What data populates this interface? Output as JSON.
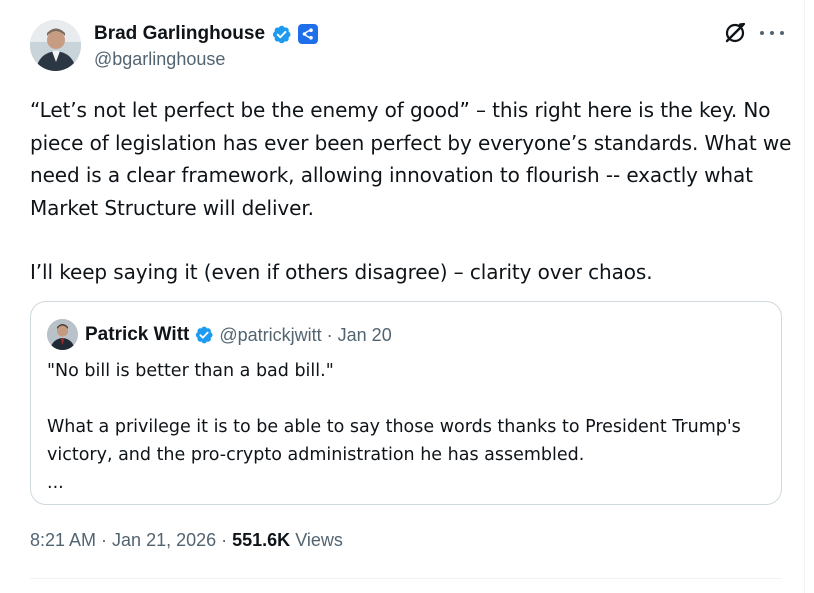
{
  "author": {
    "display_name": "Brad Garlinghouse",
    "handle": "@bgarlinghouse",
    "verified_badge_icon": "verified-badge-icon",
    "affiliation_icon": "ripple-affiliate-icon"
  },
  "header_actions": {
    "grok_icon": "grok-icon",
    "more_icon": "more-horizontal-icon"
  },
  "tweet": {
    "paragraph_1": "“Let’s not let perfect be the enemy of good” – this right here is the key. No piece of legislation has ever been perfect by everyone’s standards. What we need is a clear framework, allowing innovation to flourish -- exactly what Market Structure will deliver.",
    "paragraph_2": "I’ll keep saying it (even if others disagree) – clarity over chaos."
  },
  "quote": {
    "display_name": "Patrick Witt",
    "handle": "@patrickjwitt",
    "separator": "·",
    "date": "Jan 20",
    "line_1": "\"No bill is better than a bad bill.\"",
    "line_2": "What a privilege it is to be able to say those words thanks to President Trump's victory, and the pro-crypto administration he has assembled.",
    "line_3": "..."
  },
  "meta": {
    "time": "8:21 AM",
    "sep1": "·",
    "date": "Jan 21, 2026",
    "sep2": "·",
    "views_count": "551.6K",
    "views_label": "Views"
  },
  "colors": {
    "text_primary": "#0f1419",
    "text_secondary": "#536471",
    "verified_blue": "#1d9bf0",
    "border": "#cfd9de"
  }
}
